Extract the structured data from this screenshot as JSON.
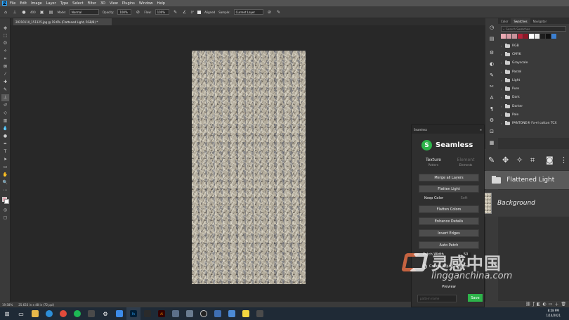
{
  "menu": {
    "app_icon": "Ps",
    "items": [
      "File",
      "Edit",
      "Image",
      "Layer",
      "Type",
      "Select",
      "Filter",
      "3D",
      "View",
      "Plugins",
      "Window",
      "Help"
    ]
  },
  "options": {
    "brush_size": "400",
    "mode_label": "Mode:",
    "mode_value": "Normal",
    "opacity_label": "Opacity:",
    "opacity_value": "100%",
    "flow_label": "Flow:",
    "flow_value": "100%",
    "angle_value": "0°",
    "aligned_label": "Aligned",
    "sample_label": "Sample:",
    "sample_value": "Current Layer"
  },
  "document": {
    "tab_title": "20210110_151125.jpg @ 19.6% (Flattened Light, RGB/8) *",
    "zoom": "19.58%",
    "dimensions": "25.633 in x 48 in (72 ppi)"
  },
  "swatches_panel": {
    "tabs": [
      "Color",
      "Swatches",
      "Navigator"
    ],
    "active_tab": "Swatches",
    "search_placeholder": "Search Swatches",
    "colors": [
      "#e9a9b2",
      "#d79aa4",
      "#c5929a",
      "#b8233a",
      "#8f1726",
      "#ffffff",
      "#e9e9e9",
      "#1e1e1e",
      "#111111",
      "#3b7fd1"
    ],
    "folders": [
      "RGB",
      "CMYK",
      "Grayscale",
      "Pastel",
      "Light",
      "Pure",
      "Dark",
      "Darker",
      "Pale",
      "PANTONE® Fx+I cotton TCX"
    ]
  },
  "seamless": {
    "panel_title": "Seamless",
    "brand": "Seamless",
    "tab_texture": "Texture",
    "tab_texture_sub": "Pattern",
    "tab_element": "Element",
    "tab_element_sub": "Elements",
    "buttons": {
      "merge": "Merge all Layers",
      "flatten_light": "Flatten Light",
      "keep_color": "Keep Color",
      "soft": "Soft",
      "flatten_colors": "Flatten Colors",
      "enhance": "Enhance Details",
      "invert_edges": "Invert Edges",
      "auto_patch": "Auto Patch",
      "create_adjust": "Create Adjust Patterns",
      "preview": "Preview"
    },
    "patch_width_label": "Patch Width",
    "patch_width_value": "50",
    "pattern_placeholder": "pattern name",
    "save_label": "Save"
  },
  "layers": {
    "active_layer": "Flattened Light",
    "background_layer": "Background"
  },
  "watermark": {
    "chinese": "灵感中国",
    "domain": "lingganchina.com"
  },
  "taskbar": {
    "time": "8:58 PM",
    "date": "1/14/2021"
  }
}
